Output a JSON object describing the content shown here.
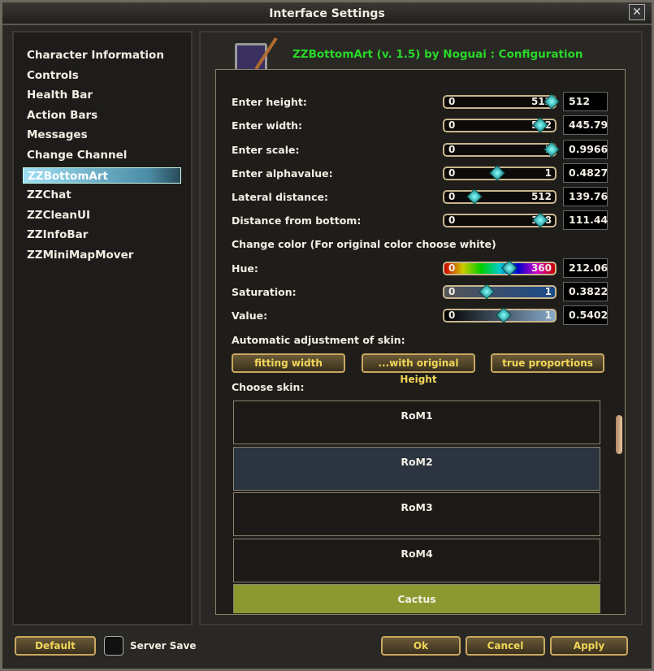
{
  "window": {
    "title": "Interface Settings",
    "close": "✕"
  },
  "sidebar": {
    "items": [
      {
        "label": "Character Information"
      },
      {
        "label": "Controls"
      },
      {
        "label": "Health Bar"
      },
      {
        "label": "Action Bars"
      },
      {
        "label": "Messages"
      },
      {
        "label": "Change Channel"
      },
      {
        "label": "ZZBottomArt",
        "selected": true
      },
      {
        "label": "ZZChat"
      },
      {
        "label": "ZZCleanUI"
      },
      {
        "label": "ZZInfoBar"
      },
      {
        "label": "ZZMiniMapMover"
      }
    ]
  },
  "config": {
    "title": "ZZBottomArt (v. 1.5) by Noguai : Configuration",
    "sliders": [
      {
        "label": "Enter height:",
        "min": "0",
        "max": "512",
        "value": "512",
        "fraction": 0.97
      },
      {
        "label": "Enter width:",
        "min": "0",
        "max": "512",
        "value": "445.79",
        "fraction": 0.87
      },
      {
        "label": "Enter scale:",
        "min": "0",
        "max": "1",
        "value": "0.9966",
        "fraction": 0.97
      },
      {
        "label": "Enter alphavalue:",
        "min": "0",
        "max": "1",
        "value": "0.4827",
        "fraction": 0.48
      },
      {
        "label": "Lateral distance:",
        "min": "0",
        "max": "512",
        "value": "139.76",
        "fraction": 0.27
      },
      {
        "label": "Distance from bottom:",
        "min": "0",
        "max": "128",
        "value": "111.44",
        "fraction": 0.87
      }
    ],
    "color_heading": "Change color (For original color choose white)",
    "color_sliders": [
      {
        "label": "Hue:",
        "min": "0",
        "max": "360",
        "value": "212.06",
        "fraction": 0.59
      },
      {
        "label": "Saturation:",
        "min": "0",
        "max": "1",
        "value": "0.3822",
        "fraction": 0.38
      },
      {
        "label": "Value:",
        "min": "0",
        "max": "1",
        "value": "0.5402",
        "fraction": 0.54
      }
    ],
    "auto_heading": "Automatic adjustment of skin:",
    "auto_buttons": [
      "fitting width",
      "...with original Height",
      "true proportions"
    ],
    "skin_heading": "Choose skin:",
    "skins": [
      "RoM1",
      "RoM2",
      "RoM3",
      "RoM4",
      "Cactus"
    ]
  },
  "footer": {
    "default": "Default",
    "server_save": "Server Save",
    "ok": "Ok",
    "cancel": "Cancel",
    "apply": "Apply"
  }
}
